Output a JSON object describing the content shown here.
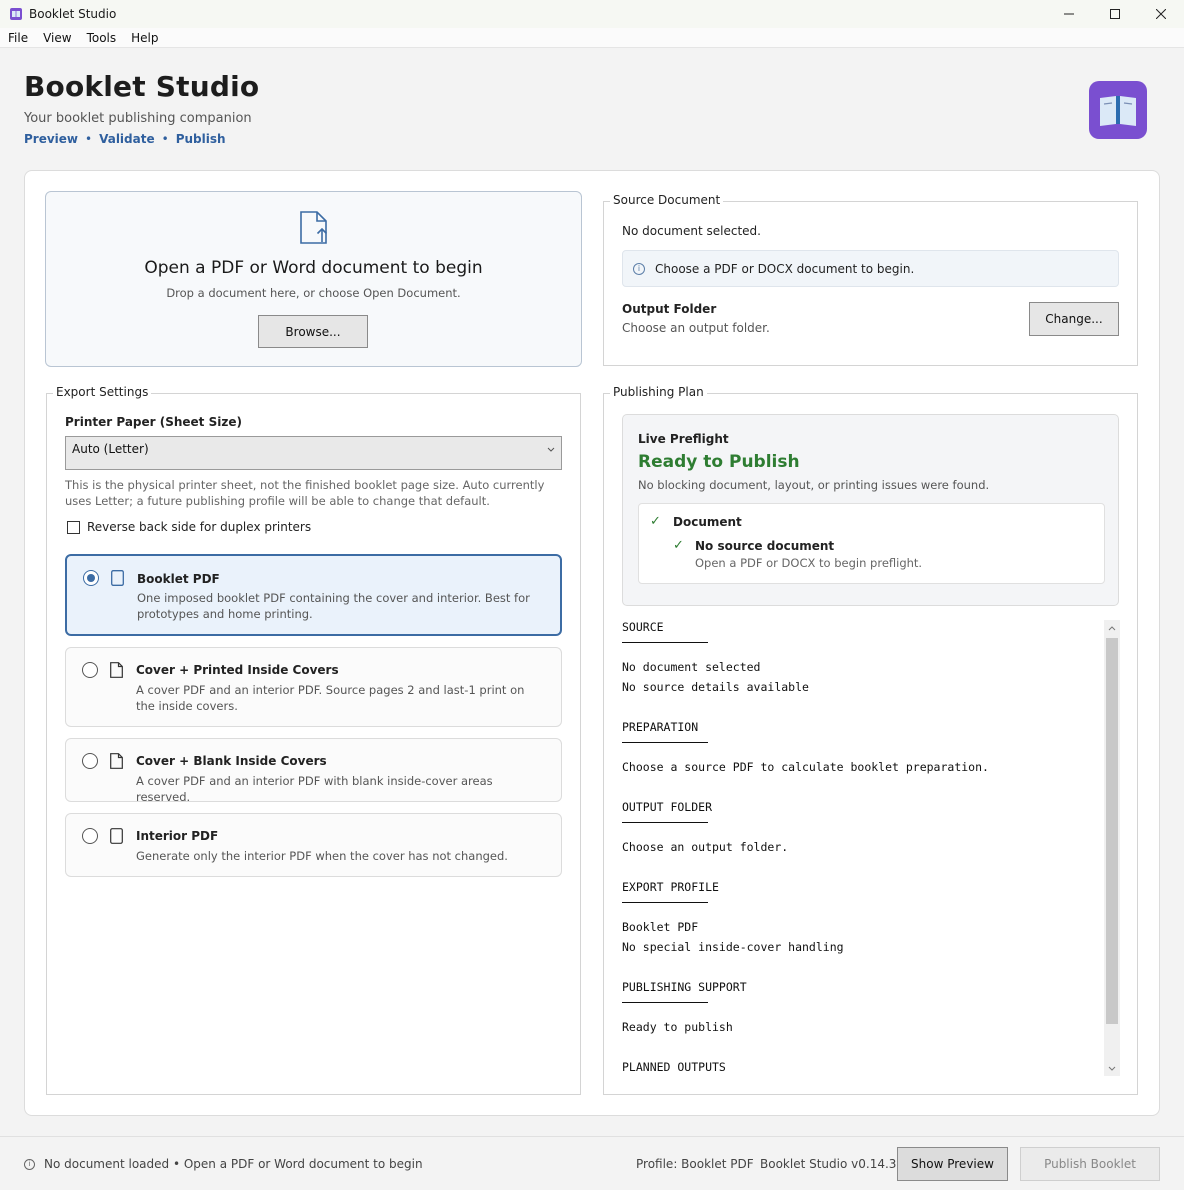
{
  "window": {
    "title": "Booklet Studio",
    "minimize": "—",
    "maximize": "☐",
    "close": "✕"
  },
  "menu": [
    "File",
    "View",
    "Tools",
    "Help"
  ],
  "header": {
    "title": "Booklet Studio",
    "subtitle": "Your booklet publishing companion",
    "links": [
      "Preview",
      "Validate",
      "Publish"
    ],
    "separator": "•"
  },
  "colors": {
    "accent": "#3c6ca4",
    "brand": "#7a4fd0",
    "success": "#2e7d32"
  },
  "dropzone": {
    "title": "Open a PDF or Word document to begin",
    "subtitle": "Drop a document here, or choose Open Document.",
    "browse_label": "Browse...",
    "icon": "document-upload-icon"
  },
  "source": {
    "legend": "Source Document",
    "status": "No document selected.",
    "info": "Choose a PDF or DOCX document to begin.",
    "output_label": "Output Folder",
    "output_sub": "Choose an output folder.",
    "change_label": "Change..."
  },
  "export": {
    "legend": "Export Settings",
    "paper_label": "Printer Paper (Sheet Size)",
    "paper_value": "Auto (Letter)",
    "paper_help": "This is the physical printer sheet, not the finished booklet page size. Auto currently uses Letter; a future publishing profile will be able to change that default.",
    "reverse_label": "Reverse back side for duplex printers",
    "reverse_checked": false,
    "options": [
      {
        "title": "Booklet PDF",
        "desc": "One imposed booklet PDF containing the cover and interior. Best for prototypes and home printing.",
        "selected": true
      },
      {
        "title": "Cover + Printed Inside Covers",
        "desc": "A cover PDF and an interior PDF. Source pages 2 and last-1 print on the inside covers.",
        "selected": false
      },
      {
        "title": "Cover + Blank Inside Covers",
        "desc": "A cover PDF and an interior PDF with blank inside-cover areas reserved.",
        "selected": false
      },
      {
        "title": "Interior PDF",
        "desc": "Generate only the interior PDF when the cover has not changed.",
        "selected": false
      }
    ]
  },
  "plan": {
    "legend": "Publishing Plan",
    "preflight_label": "Live Preflight",
    "preflight_status": "Ready to Publish",
    "preflight_sub": "No blocking document, layout, or printing issues were found.",
    "check_mark": "✓",
    "doc_label": "Document",
    "item_title": "No source document",
    "item_sub": "Open a PDF or DOCX to begin preflight.",
    "sections": [
      {
        "heading": "SOURCE",
        "lines": [
          "No document selected",
          "No source details available"
        ]
      },
      {
        "heading": "PREPARATION",
        "lines": [
          "Choose a source PDF to calculate booklet preparation."
        ]
      },
      {
        "heading": "OUTPUT FOLDER",
        "lines": [
          "Choose an output folder."
        ]
      },
      {
        "heading": "EXPORT PROFILE",
        "lines": [
          "Booklet PDF",
          "No special inside-cover handling"
        ]
      },
      {
        "heading": "PUBLISHING SUPPORT",
        "lines": [
          "Ready to publish"
        ]
      },
      {
        "heading": "PLANNED OUTPUTS",
        "lines": []
      }
    ]
  },
  "statusbar": {
    "info": "No document loaded • Open a PDF or Word document to begin",
    "profile": "Profile: Booklet PDF",
    "version": "Booklet Studio v0.14.3",
    "show_preview": "Show Preview",
    "publish": "Publish Booklet"
  }
}
